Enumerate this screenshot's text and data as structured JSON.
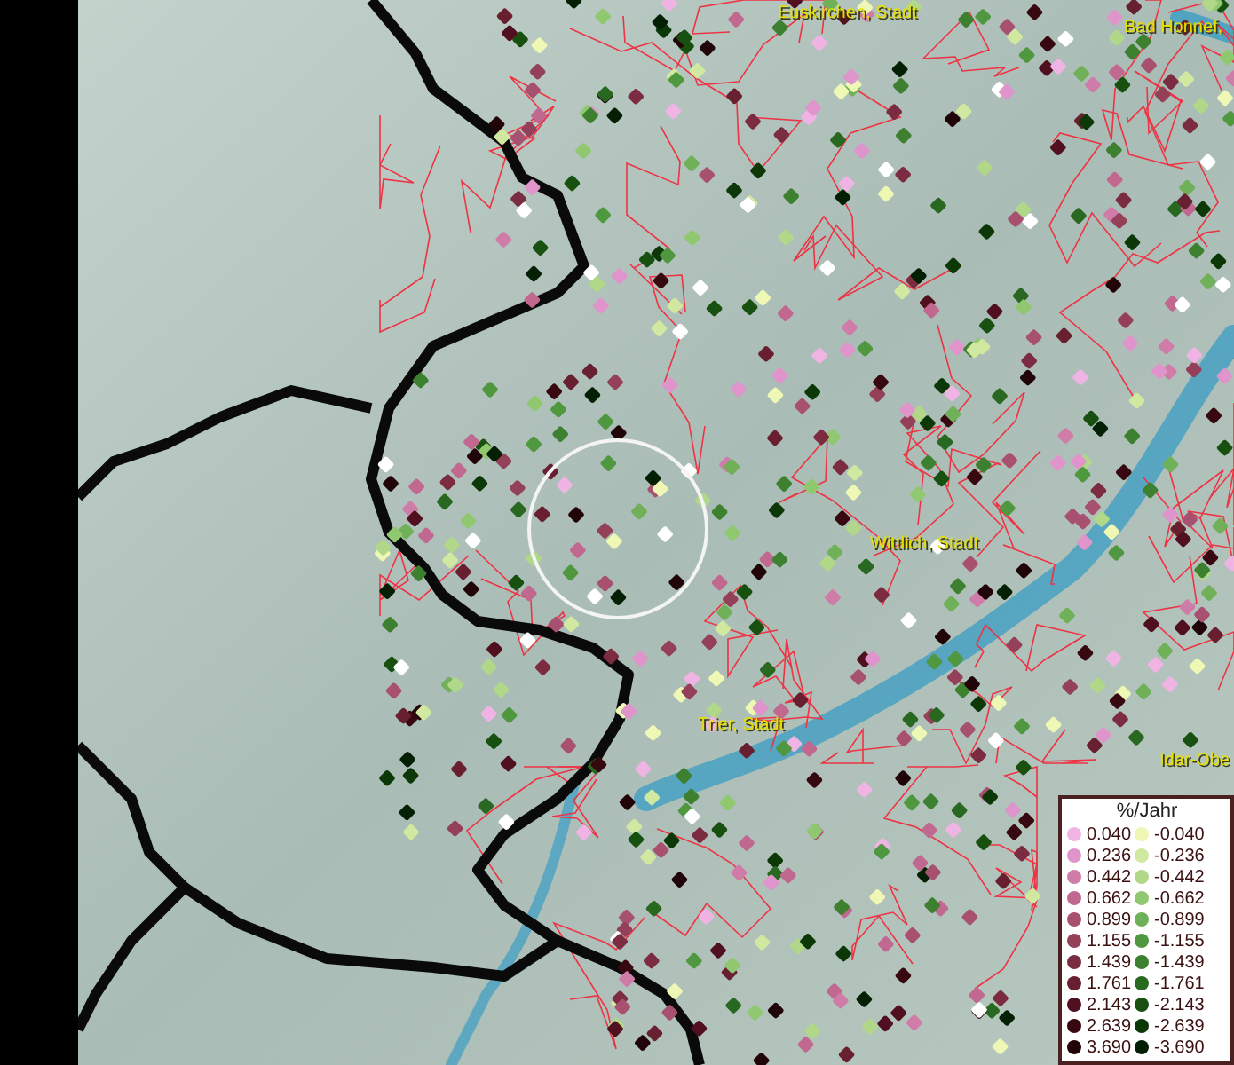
{
  "map": {
    "place_labels": [
      "Euskirchen, Stadt",
      "Bad Honnef,",
      "Wittlich, Stadt",
      "Trier, Stadt",
      "Idar-Obe"
    ]
  },
  "legend": {
    "title": "%/Jahr",
    "rows": [
      {
        "positive": {
          "value": "0.040",
          "color": "#f0b4e4"
        },
        "negative": {
          "value": "-0.040",
          "color": "#eef8b4"
        }
      },
      {
        "positive": {
          "value": "0.236",
          "color": "#e094cc"
        },
        "negative": {
          "value": "-0.236",
          "color": "#d0e8a0"
        }
      },
      {
        "positive": {
          "value": "0.442",
          "color": "#d07ca8"
        },
        "negative": {
          "value": "-0.442",
          "color": "#b0d888"
        }
      },
      {
        "positive": {
          "value": "0.662",
          "color": "#c06890"
        },
        "negative": {
          "value": "-0.662",
          "color": "#90c870"
        }
      },
      {
        "positive": {
          "value": "0.899",
          "color": "#a85070"
        },
        "negative": {
          "value": "-0.899",
          "color": "#70b058"
        }
      },
      {
        "positive": {
          "value": "1.155",
          "color": "#944058"
        },
        "negative": {
          "value": "-1.155",
          "color": "#509840"
        }
      },
      {
        "positive": {
          "value": "1.439",
          "color": "#7c2c40"
        },
        "negative": {
          "value": "-1.439",
          "color": "#3c8030"
        }
      },
      {
        "positive": {
          "value": "1.761",
          "color": "#682030"
        },
        "negative": {
          "value": "-1.761",
          "color": "#286820"
        }
      },
      {
        "positive": {
          "value": "2.143",
          "color": "#501020"
        },
        "negative": {
          "value": "-2.143",
          "color": "#185010"
        }
      },
      {
        "positive": {
          "value": "2.639",
          "color": "#380810"
        },
        "negative": {
          "value": "-2.639",
          "color": "#0c3808"
        }
      },
      {
        "positive": {
          "value": "3.690",
          "color": "#200408"
        },
        "negative": {
          "value": "-3.690",
          "color": "#042004"
        }
      }
    ]
  }
}
